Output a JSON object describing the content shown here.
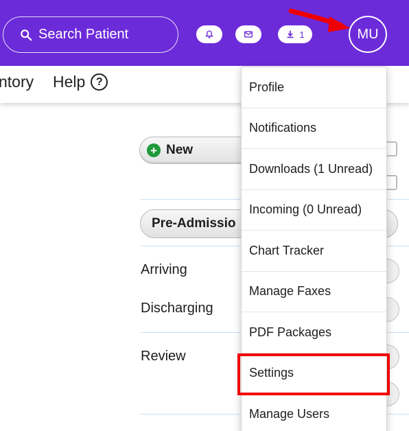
{
  "header": {
    "search_placeholder": "Search Patient",
    "download_count": "1",
    "avatar_initials": "MU",
    "brand_color": "#6c2bd9"
  },
  "nav": {
    "inventory_label": "ntory",
    "help_label": "Help",
    "help_icon_glyph": "?"
  },
  "main": {
    "new_button_label": "New",
    "new_button_icon": "+",
    "pre_admission_label": "Pre-Admissio",
    "rows": [
      "Arriving",
      "Discharging",
      "Review"
    ]
  },
  "user_menu": {
    "items": [
      "Profile",
      "Notifications",
      "Downloads (1 Unread)",
      "Incoming (0 Unread)",
      "Chart Tracker",
      "Manage Faxes",
      "PDF Packages",
      "Settings",
      "Manage Users"
    ],
    "highlighted_item": "Settings",
    "annotation_color": "#f00000"
  }
}
